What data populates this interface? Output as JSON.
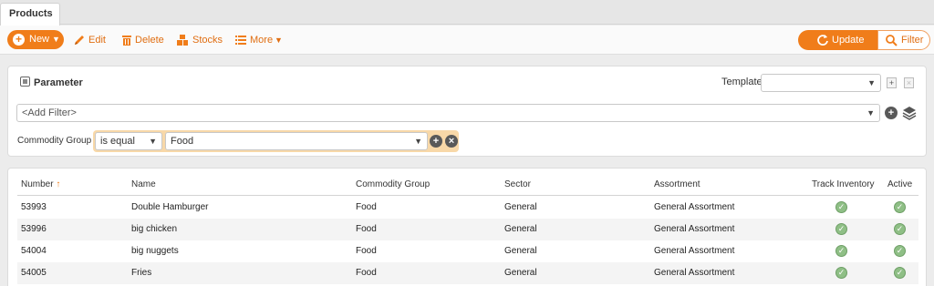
{
  "tabs": [
    {
      "label": "Products"
    }
  ],
  "toolbar": {
    "new_label": "New",
    "edit_label": "Edit",
    "delete_label": "Delete",
    "stocks_label": "Stocks",
    "more_label": "More",
    "update_label": "Update",
    "filter_label": "Filter"
  },
  "parameter": {
    "title": "Parameter",
    "template_label": "Template",
    "template_value": "",
    "add_filter_placeholder": "<Add Filter>",
    "filter_field_label": "Commodity Group",
    "operator": "is equal",
    "value": "Food"
  },
  "table": {
    "headers": {
      "number": "Number",
      "name": "Name",
      "commodity_group": "Commodity Group",
      "sector": "Sector",
      "assortment": "Assortment",
      "track_inventory": "Track Inventory",
      "active": "Active"
    },
    "sort_indicator": "↑",
    "rows": [
      {
        "number": "53993",
        "name": "Double Hamburger",
        "commodity_group": "Food",
        "sector": "General",
        "assortment": "General Assortment",
        "track_inventory": true,
        "active": true
      },
      {
        "number": "53996",
        "name": "big chicken",
        "commodity_group": "Food",
        "sector": "General",
        "assortment": "General Assortment",
        "track_inventory": true,
        "active": true
      },
      {
        "number": "54004",
        "name": "big nuggets",
        "commodity_group": "Food",
        "sector": "General",
        "assortment": "General Assortment",
        "track_inventory": true,
        "active": true
      },
      {
        "number": "54005",
        "name": "Fries",
        "commodity_group": "Food",
        "sector": "General",
        "assortment": "General Assortment",
        "track_inventory": true,
        "active": true
      }
    ]
  },
  "colors": {
    "accent": "#f07d1a",
    "check": "#8fbf86",
    "highlight": "#f8d8a8"
  }
}
